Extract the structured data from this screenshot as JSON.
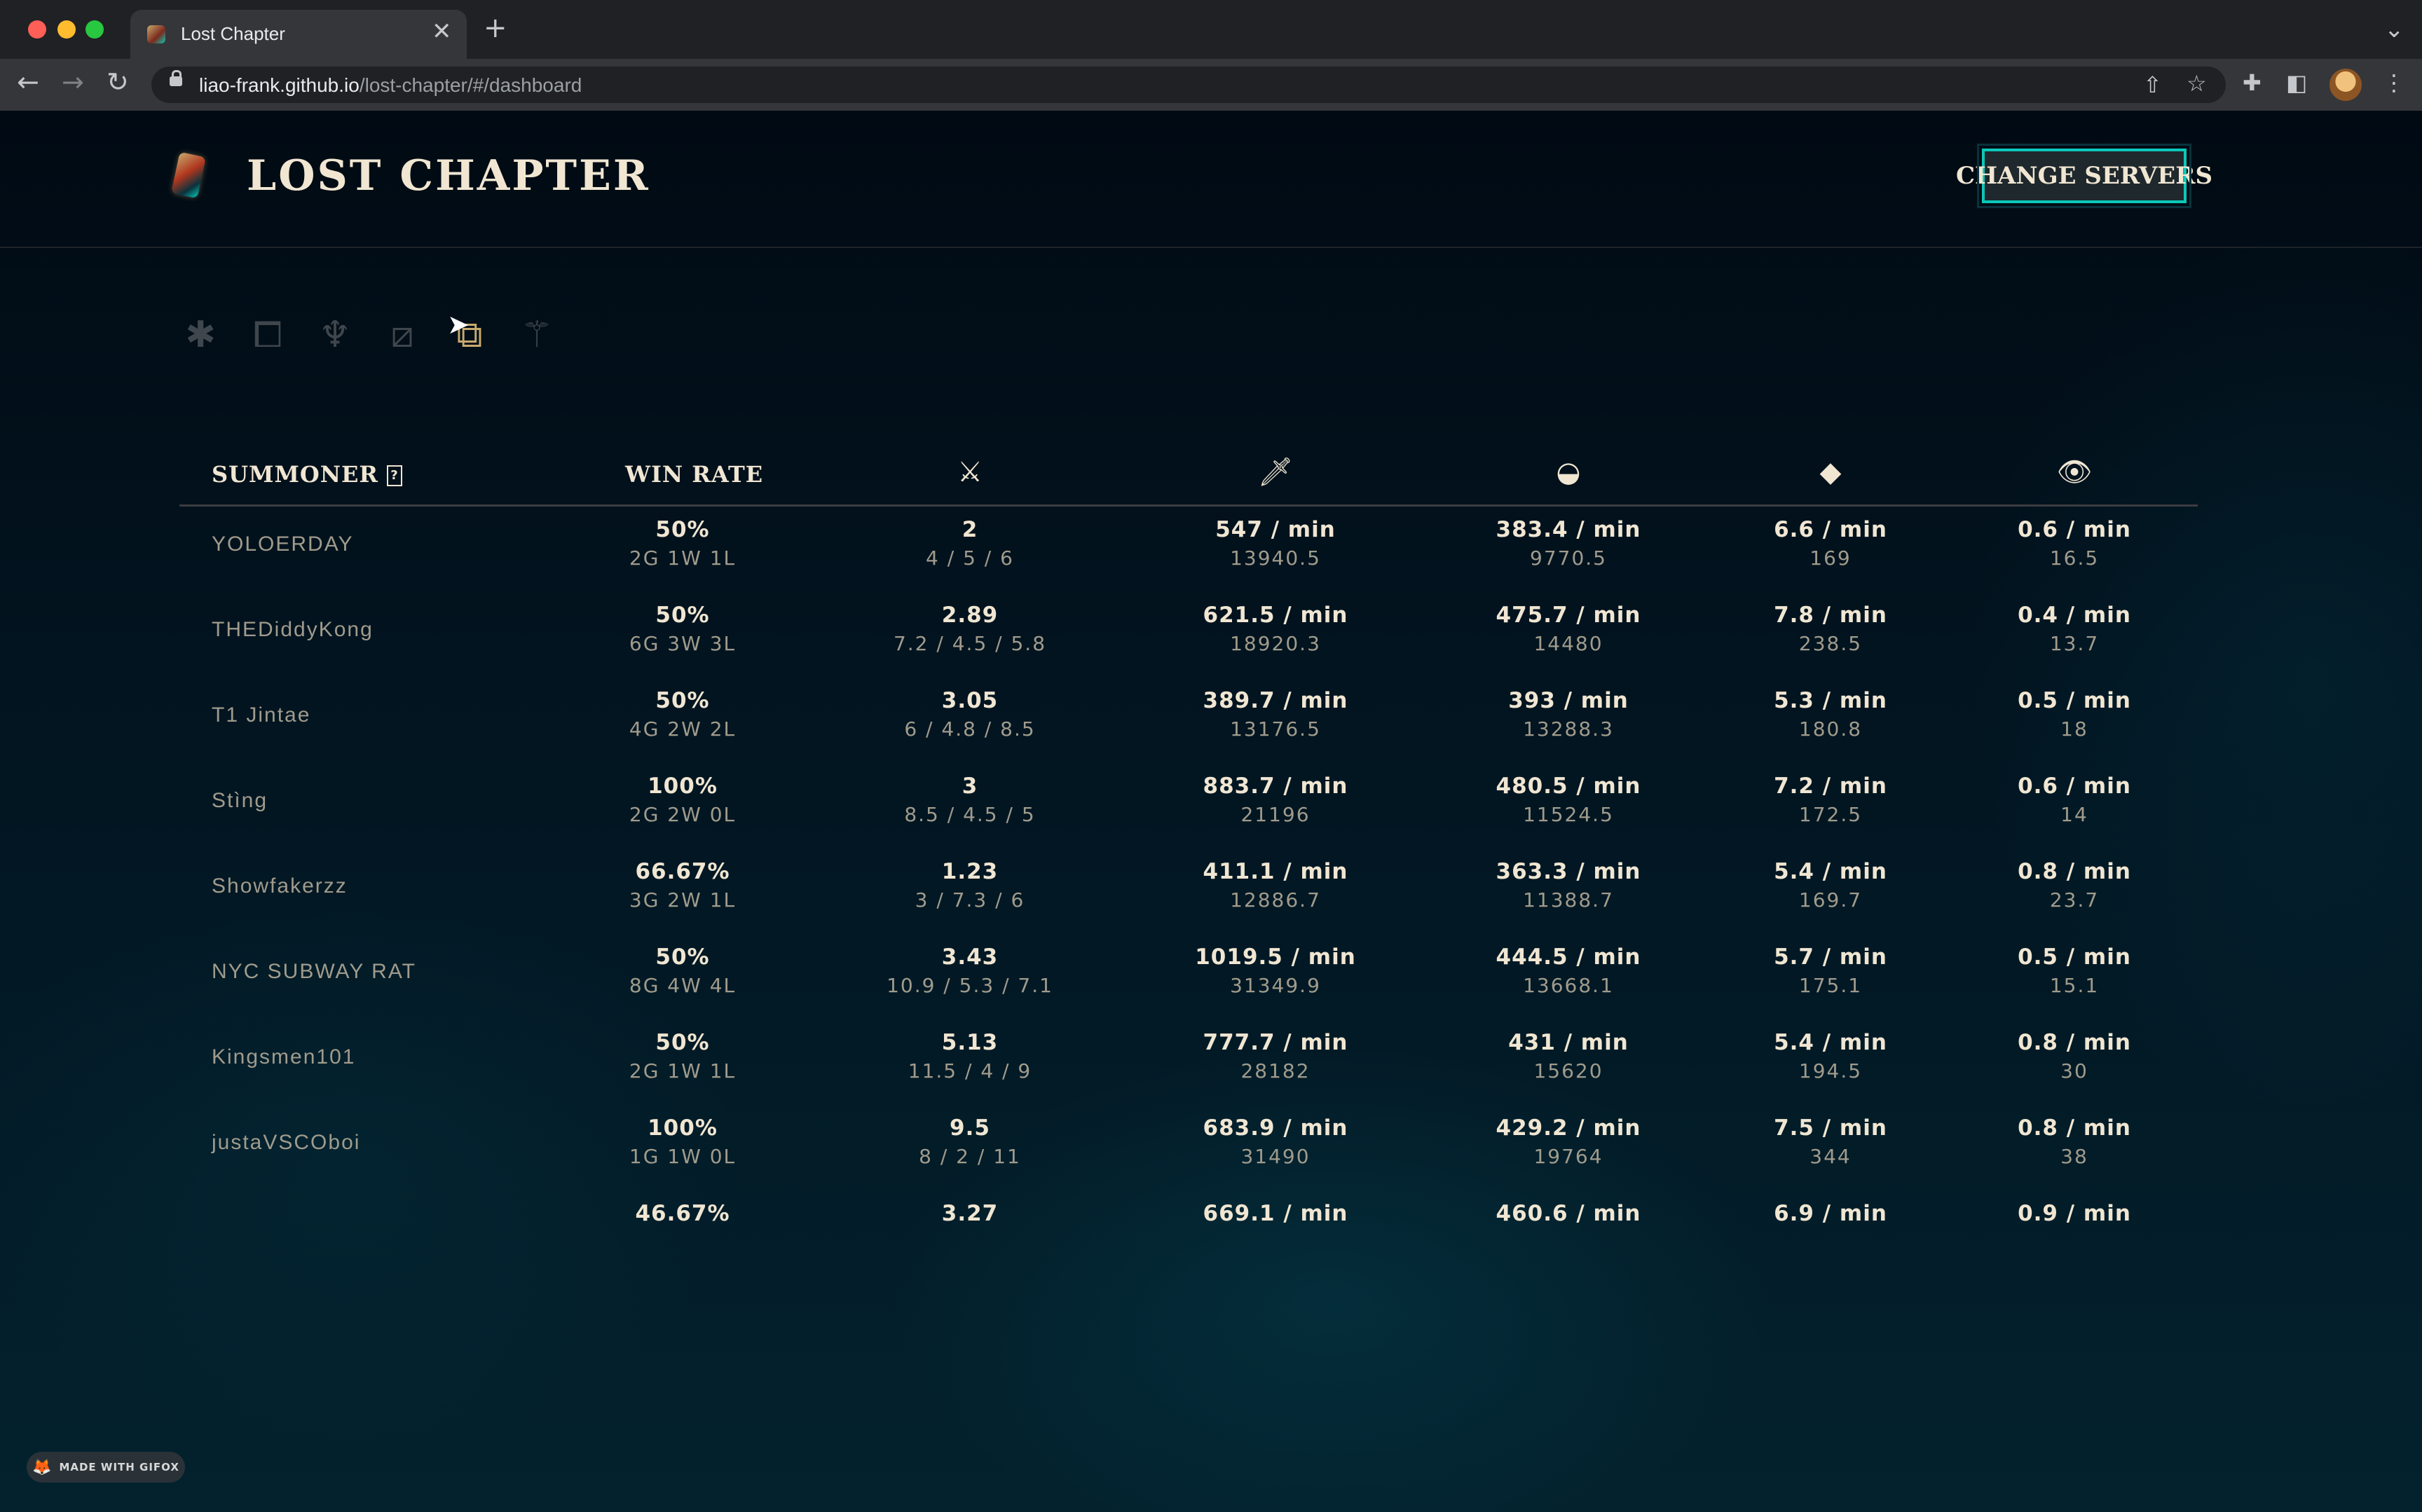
{
  "browser": {
    "tab_title": "Lost Chapter",
    "url_host": "liao-frank.github.io",
    "url_path": "/lost-chapter/#/dashboard",
    "close_glyph": "✕",
    "new_tab_glyph": "+",
    "tab_menu_glyph": "⌄",
    "back_glyph": "←",
    "forward_glyph": "→",
    "reload_glyph": "↻",
    "share_glyph": "⇧",
    "bookmark_glyph": "☆",
    "extensions_glyph": "✚",
    "sidepanel_glyph": "◧",
    "menu_glyph": "⋮"
  },
  "header": {
    "title": "LOST CHAPTER",
    "change_servers_label": "CHANGE SERVERS"
  },
  "filters": [
    {
      "name": "all-roles-icon",
      "glyph": "✱",
      "active": false
    },
    {
      "name": "top-role-icon",
      "glyph": "⧠",
      "active": false
    },
    {
      "name": "jungle-role-icon",
      "glyph": "♆",
      "active": false
    },
    {
      "name": "mid-role-icon",
      "glyph": "⧄",
      "active": false
    },
    {
      "name": "bottom-role-icon",
      "glyph": "⧉",
      "active": true
    },
    {
      "name": "support-role-icon",
      "glyph": "⚚",
      "active": false
    }
  ],
  "table": {
    "summoner_header": "SUMMONER",
    "help_glyph": "?",
    "winrate_header": "WIN RATE",
    "column_icons": [
      {
        "name": "kda-icon",
        "glyph": "⚔"
      },
      {
        "name": "damage-icon",
        "glyph": "🗡"
      },
      {
        "name": "gold-icon",
        "glyph": "◒"
      },
      {
        "name": "cs-icon",
        "glyph": "◆"
      },
      {
        "name": "vision-icon",
        "glyph": "👁"
      }
    ],
    "rows": [
      {
        "summoner": "YOLOERDAY",
        "winrate": "50%",
        "record": "2G 1W 1L",
        "kda": "2",
        "kda_detail": "4 / 5 / 6",
        "dmg": "547 / min",
        "dmg_total": "13940.5",
        "gold": "383.4 / min",
        "gold_total": "9770.5",
        "cs": "6.6 / min",
        "cs_total": "169",
        "vision": "0.6 / min",
        "vision_total": "16.5"
      },
      {
        "summoner": "THEDiddyKong",
        "winrate": "50%",
        "record": "6G 3W 3L",
        "kda": "2.89",
        "kda_detail": "7.2 / 4.5 / 5.8",
        "dmg": "621.5 / min",
        "dmg_total": "18920.3",
        "gold": "475.7 / min",
        "gold_total": "14480",
        "cs": "7.8 / min",
        "cs_total": "238.5",
        "vision": "0.4 / min",
        "vision_total": "13.7"
      },
      {
        "summoner": "T1 Jintae",
        "winrate": "50%",
        "record": "4G 2W 2L",
        "kda": "3.05",
        "kda_detail": "6 / 4.8 / 8.5",
        "dmg": "389.7 / min",
        "dmg_total": "13176.5",
        "gold": "393 / min",
        "gold_total": "13288.3",
        "cs": "5.3 / min",
        "cs_total": "180.8",
        "vision": "0.5 / min",
        "vision_total": "18"
      },
      {
        "summoner": "Stìng",
        "winrate": "100%",
        "record": "2G 2W 0L",
        "kda": "3",
        "kda_detail": "8.5 / 4.5 / 5",
        "dmg": "883.7 / min",
        "dmg_total": "21196",
        "gold": "480.5 / min",
        "gold_total": "11524.5",
        "cs": "7.2 / min",
        "cs_total": "172.5",
        "vision": "0.6 / min",
        "vision_total": "14"
      },
      {
        "summoner": "Showfakerzz",
        "winrate": "66.67%",
        "record": "3G 2W 1L",
        "kda": "1.23",
        "kda_detail": "3 / 7.3 / 6",
        "dmg": "411.1 / min",
        "dmg_total": "12886.7",
        "gold": "363.3 / min",
        "gold_total": "11388.7",
        "cs": "5.4 / min",
        "cs_total": "169.7",
        "vision": "0.8 / min",
        "vision_total": "23.7"
      },
      {
        "summoner": "NYC SUBWAY RAT",
        "winrate": "50%",
        "record": "8G 4W 4L",
        "kda": "3.43",
        "kda_detail": "10.9 / 5.3 / 7.1",
        "dmg": "1019.5 / min",
        "dmg_total": "31349.9",
        "gold": "444.5 / min",
        "gold_total": "13668.1",
        "cs": "5.7 / min",
        "cs_total": "175.1",
        "vision": "0.5 / min",
        "vision_total": "15.1"
      },
      {
        "summoner": "Kingsmen101",
        "winrate": "50%",
        "record": "2G 1W 1L",
        "kda": "5.13",
        "kda_detail": "11.5 / 4 / 9",
        "dmg": "777.7 / min",
        "dmg_total": "28182",
        "gold": "431 / min",
        "gold_total": "15620",
        "cs": "5.4 / min",
        "cs_total": "194.5",
        "vision": "0.8 / min",
        "vision_total": "30"
      },
      {
        "summoner": "justaVSCOboi",
        "winrate": "100%",
        "record": "1G 1W 0L",
        "kda": "9.5",
        "kda_detail": "8 / 2 / 11",
        "dmg": "683.9 / min",
        "dmg_total": "31490",
        "gold": "429.2 / min",
        "gold_total": "19764",
        "cs": "7.5 / min",
        "cs_total": "344",
        "vision": "0.8 / min",
        "vision_total": "38"
      },
      {
        "summoner": "",
        "winrate": "46.67%",
        "record": "",
        "kda": "3.27",
        "kda_detail": "",
        "dmg": "669.1 / min",
        "dmg_total": "",
        "gold": "460.6 / min",
        "gold_total": "",
        "cs": "6.9 / min",
        "cs_total": "",
        "vision": "0.9 / min",
        "vision_total": ""
      }
    ]
  },
  "badge": {
    "label": "MADE WITH GIFOX",
    "glyph": "🦊"
  }
}
